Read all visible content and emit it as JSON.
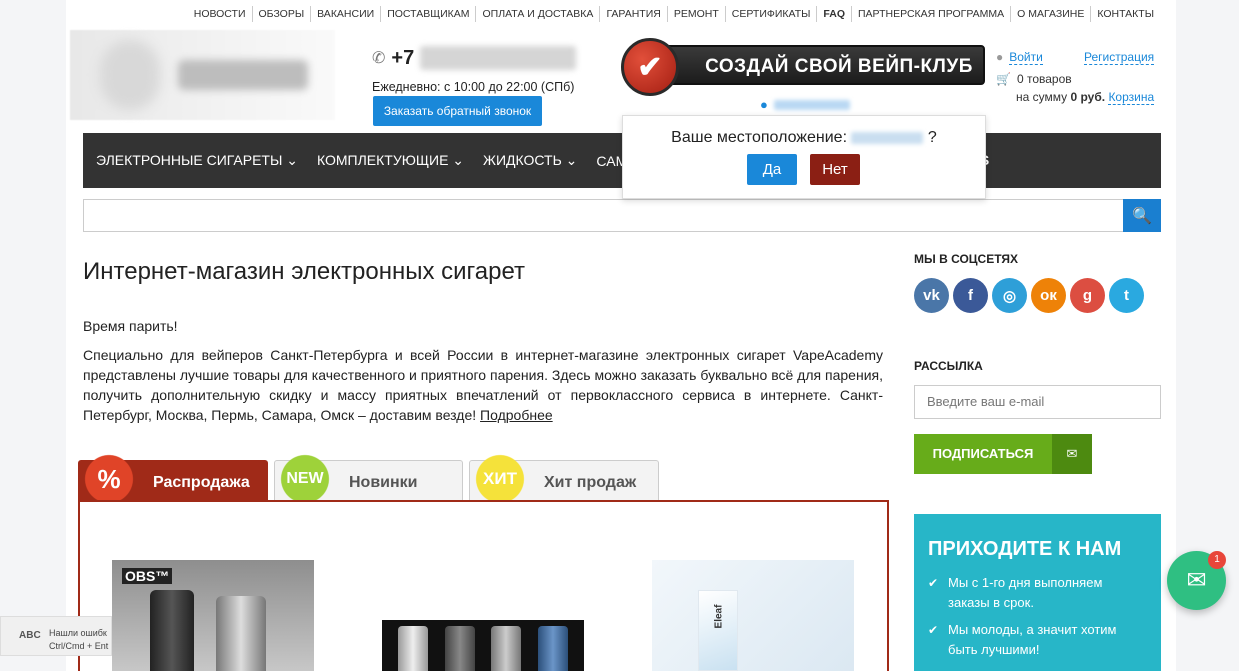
{
  "topnav": [
    {
      "label": "НОВОСТИ"
    },
    {
      "label": "ОБЗОРЫ"
    },
    {
      "label": "ВАКАНСИИ"
    },
    {
      "label": "ПОСТАВЩИКАМ"
    },
    {
      "label": "ОПЛАТА И ДОСТАВКА"
    },
    {
      "label": "ГАРАНТИЯ"
    },
    {
      "label": "РЕМОНТ"
    },
    {
      "label": "СЕРТИФИКАТЫ"
    },
    {
      "label": "FAQ"
    },
    {
      "label": "ПАРТНЕРСКАЯ ПРОГРАММА"
    },
    {
      "label": "О МАГАЗИНЕ"
    },
    {
      "label": "КОНТАКТЫ"
    }
  ],
  "header": {
    "phone_prefix": "+7",
    "hours": "Ежедневно: с 10:00 до 22:00 (СПб)",
    "callback_label": "Заказать обратный звонок",
    "club_banner": "СОЗДАЙ СВОЙ ВЕЙП-КЛУБ",
    "login": "Войти",
    "register": "Регистрация",
    "cart_count": "0 товаров",
    "cart_sum_prefix": "на сумму",
    "cart_sum": "0 руб.",
    "cart_link": "Корзина"
  },
  "menu": {
    "items": [
      "ЭЛЕКТРОННЫЕ СИГАРЕТЫ",
      "КОМПЛЕКТУЮЩИЕ",
      "ЖИДКОСТЬ",
      "САМ"
    ],
    "tail": "OS"
  },
  "location_popup": {
    "question": "Ваше местоположение:",
    "question_mark": "?",
    "yes": "Да",
    "no": "Нет"
  },
  "main": {
    "title": "Интернет-магазин электронных сигарет",
    "intro": "Время парить!",
    "body": "Специально для вейперов Санкт-Петербурга и всей России в интернет-магазине электронных сигарет VapeAcademy представлены лучшие товары для качественного и приятного парения. Здесь можно заказать буквально всё для парения, получить дополнительную скидку и массу приятных впечатлений от первоклассного сервиса в интернете. Санкт-Петербург, Москва, Пермь, Самара, Омск – доставим везде!",
    "more_link": "Подробнее"
  },
  "tabs": [
    {
      "badge": "%",
      "label": "Распродажа"
    },
    {
      "badge": "NEW",
      "label": "Новинки"
    },
    {
      "badge": "ХИТ",
      "label": "Хит продаж"
    }
  ],
  "products": {
    "p1_brand": "OBS™",
    "p3_brand": "Eleaf"
  },
  "sidebar": {
    "social_title": "МЫ В СОЦСЕТЯХ",
    "socials": [
      {
        "icon": "vk-icon",
        "glyph": "vk",
        "color": "#4a76a8"
      },
      {
        "icon": "facebook-icon",
        "glyph": "f",
        "color": "#3b5998"
      },
      {
        "icon": "instagram-icon",
        "glyph": "◎",
        "color": "#2e9fd8"
      },
      {
        "icon": "odnoklassniki-icon",
        "glyph": "ок",
        "color": "#ee8208"
      },
      {
        "icon": "google-plus-icon",
        "glyph": "g",
        "color": "#dc4e41"
      },
      {
        "icon": "twitter-icon",
        "glyph": "t",
        "color": "#2aa9e0"
      }
    ],
    "newsletter_title": "РАССЫЛКА",
    "email_placeholder": "Введите ваш e-mail",
    "subscribe_label": "ПОДПИСАТЬСЯ",
    "visit_title": "ПРИХОДИТЕ К НАМ",
    "visit_items": [
      "Мы с 1-го дня выполняем заказы в срок.",
      "Мы молоды, а значит хотим быть лучшими!"
    ]
  },
  "overlays": {
    "report_line1": "Нашли ошибк",
    "report_line2": "Ctrl/Cmd + Ent",
    "chat_count": "1"
  }
}
